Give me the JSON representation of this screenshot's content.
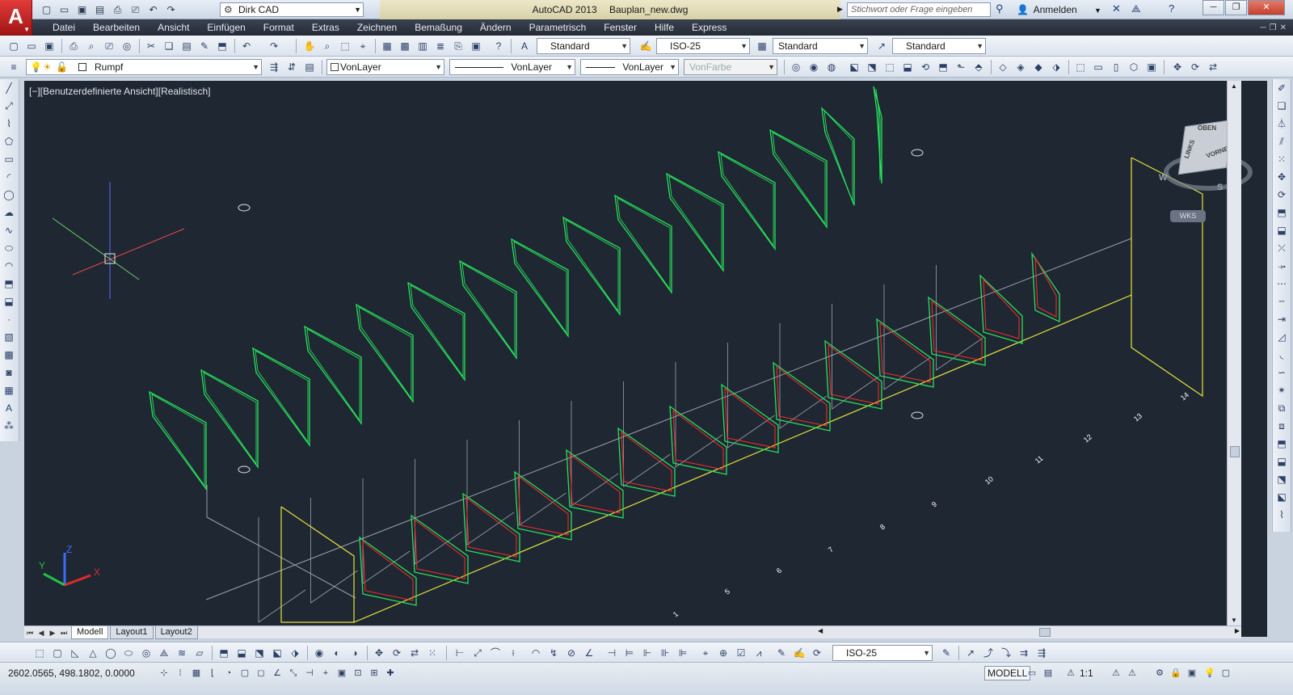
{
  "titlebar": {
    "workspace": "Dirk CAD",
    "app_name": "AutoCAD 2013",
    "file_name": "Bauplan_new.dwg",
    "search_placeholder": "Stichwort oder Frage eingeben",
    "login_label": "Anmelden"
  },
  "menu": [
    "Datei",
    "Bearbeiten",
    "Ansicht",
    "Einfügen",
    "Format",
    "Extras",
    "Zeichnen",
    "Bemaßung",
    "Ändern",
    "Parametrisch",
    "Fenster",
    "Hilfe",
    "Express"
  ],
  "styles_toolbar": {
    "text_style": "Standard",
    "dim_style": "ISO-25",
    "table_style": "Standard",
    "mleader_style": "Standard"
  },
  "layers_toolbar": {
    "current_layer": "Rumpf",
    "color": "VonLayer",
    "linetype": "VonLayer",
    "lineweight": "VonLayer",
    "plotstyle": "VonFarbe"
  },
  "viewport": {
    "label": "[−][Benutzerdefinierte Ansicht][Realistisch]",
    "background": "#1f2733",
    "viewcube": {
      "top": "OBEN",
      "left": "LINKS",
      "front": "VORNE",
      "compass_w": "W",
      "compass_s": "S",
      "ucs_button": "WKS"
    },
    "ucs_axes": {
      "x": "X",
      "y": "Y",
      "z": "Z"
    },
    "station_labels": [
      "1",
      "5",
      "6",
      "7",
      "8",
      "9",
      "10",
      "11",
      "12",
      "13",
      "14"
    ]
  },
  "colors": {
    "frame_green": "#27e05a",
    "frame_red": "#ff2a2a",
    "axis_yellow": "#e3e33a",
    "grid_gray": "#9aa2ad"
  },
  "layout_tabs": [
    "Modell",
    "Layout1",
    "Layout2"
  ],
  "bottom_toolbar": {
    "dim_style": "ISO-25"
  },
  "statusbar": {
    "coordinates": "2602.0565, 498.1802, 0.0000",
    "model_label": "MODELL",
    "annotation_scale": "1:1"
  }
}
